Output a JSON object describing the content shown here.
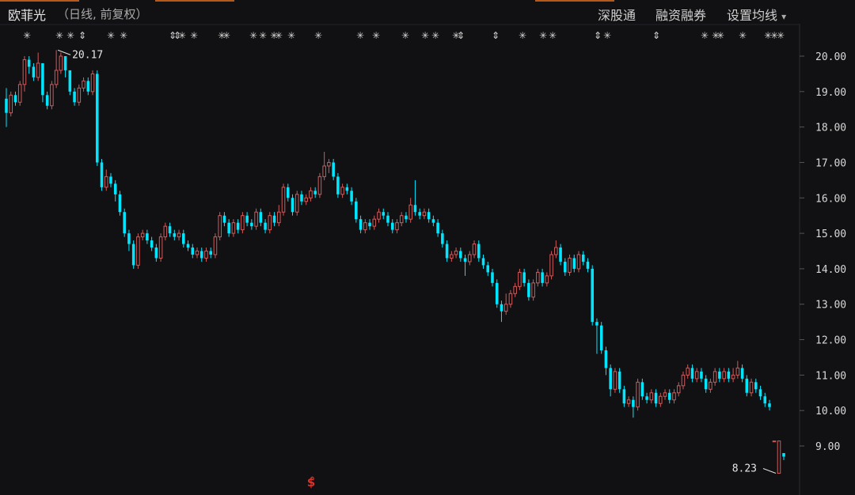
{
  "header": {
    "stock_name": "欧菲光",
    "subtitle": "（日线, 前复权）",
    "buttons": [
      "深股通",
      "融资融券",
      "设置均线"
    ],
    "dropdown_arrow": "▾"
  },
  "colors": {
    "background": "#111113",
    "up": "#d05a5a",
    "down": "#00e6ff",
    "grid": "#2a2a2e",
    "text": "#d8d8d8"
  },
  "markers": {
    "glyph_star": "✳",
    "glyph_arrow": "⇕",
    "bottom_glyph": "$̂"
  },
  "chart_data": {
    "type": "candlestick",
    "y_axis": {
      "ticks": [
        "20.00",
        "19.00",
        "18.00",
        "17.00",
        "16.00",
        "15.00",
        "14.00",
        "13.00",
        "12.00",
        "11.00",
        "10.00",
        "9.00"
      ],
      "range": [
        8.1,
        20.35
      ]
    },
    "annotations": {
      "high": "20.17",
      "low": "8.23"
    },
    "candles": [
      [
        18.8,
        18.4,
        19.1,
        18.0
      ],
      [
        18.4,
        18.9,
        19.0,
        18.3
      ],
      [
        18.9,
        18.7,
        19.0,
        18.6
      ],
      [
        18.7,
        19.2,
        19.3,
        18.6
      ],
      [
        19.2,
        19.9,
        20.0,
        19.0
      ],
      [
        19.9,
        19.7,
        20.0,
        19.5
      ],
      [
        19.7,
        19.4,
        19.8,
        19.3
      ],
      [
        19.4,
        19.8,
        20.1,
        19.3
      ],
      [
        19.8,
        18.9,
        19.8,
        18.7
      ],
      [
        18.9,
        18.6,
        19.0,
        18.5
      ],
      [
        18.6,
        19.2,
        19.3,
        18.5
      ],
      [
        19.2,
        19.6,
        20.17,
        19.1
      ],
      [
        19.6,
        20.0,
        20.1,
        19.5
      ],
      [
        20.0,
        19.6,
        20.0,
        19.4
      ],
      [
        19.6,
        19.0,
        19.6,
        18.9
      ],
      [
        19.0,
        18.7,
        19.1,
        18.6
      ],
      [
        18.7,
        19.1,
        19.2,
        18.6
      ],
      [
        19.1,
        19.3,
        19.4,
        19.0
      ],
      [
        19.3,
        19.0,
        19.4,
        18.9
      ],
      [
        19.0,
        19.5,
        19.6,
        18.9
      ],
      [
        19.5,
        17.0,
        19.6,
        16.9
      ],
      [
        17.0,
        16.3,
        17.1,
        16.2
      ],
      [
        16.3,
        16.6,
        16.8,
        16.2
      ],
      [
        16.6,
        16.4,
        16.7,
        16.3
      ],
      [
        16.4,
        16.1,
        16.5,
        15.9
      ],
      [
        16.1,
        15.6,
        16.2,
        15.5
      ],
      [
        15.6,
        15.0,
        15.7,
        14.9
      ],
      [
        15.0,
        14.7,
        15.1,
        14.5
      ],
      [
        14.7,
        14.1,
        14.8,
        14.0
      ],
      [
        14.1,
        14.9,
        15.0,
        14.0
      ],
      [
        14.9,
        15.0,
        15.1,
        14.8
      ],
      [
        15.0,
        14.8,
        15.1,
        14.7
      ],
      [
        14.8,
        14.6,
        14.9,
        14.5
      ],
      [
        14.6,
        14.3,
        14.7,
        14.2
      ],
      [
        14.3,
        14.9,
        15.0,
        14.2
      ],
      [
        14.9,
        15.2,
        15.3,
        14.8
      ],
      [
        15.2,
        15.0,
        15.3,
        14.9
      ],
      [
        15.0,
        14.9,
        15.1,
        14.8
      ],
      [
        14.9,
        15.0,
        15.1,
        14.8
      ],
      [
        15.0,
        14.7,
        15.1,
        14.6
      ],
      [
        14.7,
        14.6,
        14.8,
        14.5
      ],
      [
        14.6,
        14.4,
        14.7,
        14.3
      ],
      [
        14.4,
        14.5,
        14.6,
        14.3
      ],
      [
        14.5,
        14.3,
        14.6,
        14.2
      ],
      [
        14.3,
        14.5,
        14.6,
        14.2
      ],
      [
        14.5,
        14.4,
        14.6,
        14.3
      ],
      [
        14.4,
        14.9,
        15.0,
        14.3
      ],
      [
        14.9,
        15.5,
        15.6,
        14.8
      ],
      [
        15.5,
        15.3,
        15.6,
        15.2
      ],
      [
        15.3,
        15.0,
        15.4,
        14.9
      ],
      [
        15.0,
        15.3,
        15.4,
        14.9
      ],
      [
        15.3,
        15.1,
        15.4,
        15.0
      ],
      [
        15.1,
        15.5,
        15.6,
        15.0
      ],
      [
        15.5,
        15.3,
        15.6,
        15.2
      ],
      [
        15.3,
        15.2,
        15.4,
        15.1
      ],
      [
        15.2,
        15.6,
        15.7,
        15.1
      ],
      [
        15.6,
        15.3,
        15.7,
        15.2
      ],
      [
        15.3,
        15.1,
        15.4,
        15.0
      ],
      [
        15.1,
        15.5,
        15.6,
        15.0
      ],
      [
        15.5,
        15.3,
        15.6,
        15.2
      ],
      [
        15.3,
        15.6,
        15.8,
        15.2
      ],
      [
        15.6,
        16.3,
        16.4,
        15.5
      ],
      [
        16.3,
        16.0,
        16.4,
        15.9
      ],
      [
        16.0,
        15.6,
        16.1,
        15.5
      ],
      [
        15.6,
        16.1,
        16.2,
        15.5
      ],
      [
        16.1,
        15.9,
        16.2,
        15.8
      ],
      [
        15.9,
        16.0,
        16.1,
        15.8
      ],
      [
        16.0,
        16.2,
        16.3,
        15.9
      ],
      [
        16.2,
        16.1,
        16.3,
        16.0
      ],
      [
        16.1,
        16.6,
        16.7,
        16.0
      ],
      [
        16.6,
        16.9,
        17.3,
        16.5
      ],
      [
        16.9,
        17.0,
        17.1,
        16.7
      ],
      [
        17.0,
        16.6,
        17.1,
        16.5
      ],
      [
        16.6,
        16.1,
        16.7,
        16.0
      ],
      [
        16.1,
        16.3,
        16.4,
        16.0
      ],
      [
        16.3,
        16.2,
        16.4,
        16.1
      ],
      [
        16.2,
        15.9,
        16.3,
        15.8
      ],
      [
        15.9,
        15.4,
        16.0,
        15.3
      ],
      [
        15.4,
        15.1,
        15.5,
        15.0
      ],
      [
        15.1,
        15.3,
        15.4,
        15.0
      ],
      [
        15.3,
        15.2,
        15.4,
        15.1
      ],
      [
        15.2,
        15.4,
        15.5,
        15.1
      ],
      [
        15.4,
        15.6,
        15.7,
        15.3
      ],
      [
        15.6,
        15.5,
        15.7,
        15.4
      ],
      [
        15.5,
        15.3,
        15.6,
        15.2
      ],
      [
        15.3,
        15.1,
        15.4,
        15.0
      ],
      [
        15.1,
        15.3,
        15.4,
        15.0
      ],
      [
        15.3,
        15.5,
        15.6,
        15.2
      ],
      [
        15.5,
        15.4,
        15.6,
        15.3
      ],
      [
        15.4,
        15.8,
        16.0,
        15.3
      ],
      [
        15.8,
        15.6,
        16.5,
        15.5
      ],
      [
        15.6,
        15.5,
        15.7,
        15.4
      ],
      [
        15.5,
        15.6,
        15.7,
        15.4
      ],
      [
        15.6,
        15.4,
        15.7,
        15.3
      ],
      [
        15.4,
        15.3,
        15.5,
        15.2
      ],
      [
        15.3,
        15.0,
        15.4,
        14.9
      ],
      [
        15.0,
        14.7,
        15.1,
        14.6
      ],
      [
        14.7,
        14.3,
        14.8,
        14.2
      ],
      [
        14.3,
        14.4,
        14.5,
        14.2
      ],
      [
        14.4,
        14.5,
        14.6,
        14.3
      ],
      [
        14.5,
        14.3,
        14.6,
        14.2
      ],
      [
        14.3,
        14.2,
        14.4,
        13.8
      ],
      [
        14.2,
        14.4,
        14.5,
        14.1
      ],
      [
        14.4,
        14.7,
        14.8,
        14.3
      ],
      [
        14.7,
        14.3,
        14.8,
        14.2
      ],
      [
        14.3,
        14.1,
        14.4,
        14.0
      ],
      [
        14.1,
        13.9,
        14.2,
        13.8
      ],
      [
        13.9,
        13.6,
        14.0,
        13.5
      ],
      [
        13.6,
        13.0,
        13.7,
        12.9
      ],
      [
        13.0,
        12.8,
        13.1,
        12.5
      ],
      [
        12.8,
        13.0,
        13.3,
        12.7
      ],
      [
        13.0,
        13.3,
        13.4,
        12.9
      ],
      [
        13.3,
        13.5,
        13.6,
        13.2
      ],
      [
        13.5,
        13.9,
        14.0,
        13.4
      ],
      [
        13.9,
        13.6,
        14.0,
        13.5
      ],
      [
        13.6,
        13.2,
        13.7,
        13.1
      ],
      [
        13.2,
        13.6,
        13.7,
        13.1
      ],
      [
        13.6,
        13.9,
        14.0,
        13.5
      ],
      [
        13.9,
        13.6,
        14.0,
        13.5
      ],
      [
        13.6,
        13.8,
        13.9,
        13.5
      ],
      [
        13.8,
        14.4,
        14.5,
        13.7
      ],
      [
        14.4,
        14.6,
        14.8,
        14.3
      ],
      [
        14.6,
        14.2,
        14.7,
        14.1
      ],
      [
        14.2,
        13.9,
        14.3,
        13.8
      ],
      [
        13.9,
        14.3,
        14.4,
        13.8
      ],
      [
        14.3,
        14.0,
        14.4,
        13.9
      ],
      [
        14.0,
        14.4,
        14.5,
        13.9
      ],
      [
        14.4,
        14.2,
        14.5,
        14.1
      ],
      [
        14.2,
        14.0,
        14.3,
        13.9
      ],
      [
        14.0,
        12.5,
        14.1,
        12.4
      ],
      [
        12.5,
        12.4,
        12.6,
        11.6
      ],
      [
        12.4,
        11.7,
        12.5,
        11.6
      ],
      [
        11.7,
        11.2,
        11.8,
        11.0
      ],
      [
        11.2,
        10.6,
        11.3,
        10.4
      ],
      [
        10.6,
        11.1,
        11.2,
        10.5
      ],
      [
        11.1,
        10.6,
        11.2,
        10.5
      ],
      [
        10.6,
        10.2,
        10.7,
        10.1
      ],
      [
        10.2,
        10.3,
        10.4,
        10.1
      ],
      [
        10.3,
        10.1,
        10.4,
        9.8
      ],
      [
        10.1,
        10.8,
        10.9,
        10.0
      ],
      [
        10.8,
        10.4,
        10.9,
        10.3
      ],
      [
        10.4,
        10.3,
        10.5,
        10.2
      ],
      [
        10.3,
        10.5,
        10.6,
        10.2
      ],
      [
        10.5,
        10.2,
        10.6,
        10.1
      ],
      [
        10.2,
        10.4,
        10.5,
        10.1
      ],
      [
        10.4,
        10.5,
        10.6,
        10.3
      ],
      [
        10.5,
        10.3,
        10.6,
        10.2
      ],
      [
        10.3,
        10.5,
        10.6,
        10.2
      ],
      [
        10.5,
        10.7,
        10.8,
        10.4
      ],
      [
        10.7,
        11.0,
        11.1,
        10.6
      ],
      [
        11.0,
        11.2,
        11.3,
        10.9
      ],
      [
        11.2,
        10.9,
        11.3,
        10.8
      ],
      [
        10.9,
        11.1,
        11.2,
        10.8
      ],
      [
        11.1,
        10.9,
        11.2,
        10.8
      ],
      [
        10.9,
        10.6,
        11.0,
        10.5
      ],
      [
        10.6,
        10.8,
        10.9,
        10.5
      ],
      [
        10.8,
        11.1,
        11.2,
        10.7
      ],
      [
        11.1,
        10.9,
        11.2,
        10.8
      ],
      [
        10.9,
        11.1,
        11.2,
        10.8
      ],
      [
        11.1,
        10.9,
        11.2,
        10.8
      ],
      [
        10.9,
        11.0,
        11.2,
        10.8
      ],
      [
        11.0,
        11.2,
        11.4,
        10.9
      ],
      [
        11.2,
        10.9,
        11.3,
        10.8
      ],
      [
        10.9,
        10.5,
        11.0,
        10.4
      ],
      [
        10.5,
        10.8,
        10.9,
        10.4
      ],
      [
        10.8,
        10.6,
        10.9,
        10.5
      ],
      [
        10.6,
        10.4,
        10.7,
        10.3
      ],
      [
        10.4,
        10.2,
        10.5,
        10.1
      ],
      [
        10.2,
        10.1,
        10.3,
        10.0
      ],
      [
        9.14,
        9.14,
        9.14,
        9.14
      ],
      [
        8.23,
        9.14,
        9.15,
        8.23
      ],
      [
        8.8,
        8.7,
        8.8,
        8.6
      ]
    ]
  }
}
